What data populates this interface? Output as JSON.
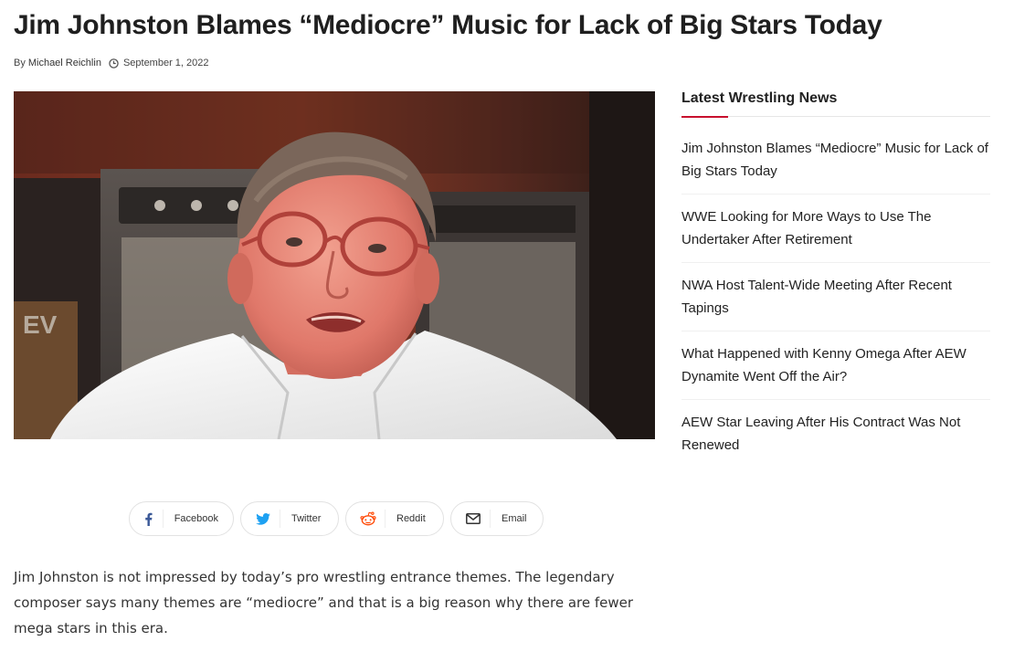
{
  "article": {
    "title": "Jim Johnston Blames “Mediocre” Music for Lack of Big Stars Today",
    "by_prefix": "By",
    "author": "Michael Reichlin",
    "date": "September 1, 2022",
    "image_text": "EV",
    "body": "Jim Johnston is not impressed by today’s pro wrestling entrance themes. The legendary composer says many themes are “mediocre” and that is a big reason why there are fewer mega stars in this era."
  },
  "share": {
    "facebook": {
      "label": "Facebook",
      "icon": "facebook-icon",
      "color": "#3b5998"
    },
    "twitter": {
      "label": "Twitter",
      "icon": "twitter-icon",
      "color": "#1da1f2"
    },
    "reddit": {
      "label": "Reddit",
      "icon": "reddit-icon",
      "color": "#ff4500"
    },
    "email": {
      "label": "Email",
      "icon": "envelope-icon",
      "color": "#333333"
    }
  },
  "sidebar": {
    "title": "Latest Wrestling News",
    "accent_color": "#c8102e",
    "items": [
      "Jim Johnston Blames “Mediocre” Music for Lack of Big Stars Today",
      "WWE Looking for More Ways to Use The Undertaker After Retirement",
      "NWA Host Talent-Wide Meeting After Recent Tapings",
      "What Happened with Kenny Omega After AEW Dynamite Went Off the Air?",
      "AEW Star Leaving After His Contract Was Not Renewed"
    ]
  }
}
